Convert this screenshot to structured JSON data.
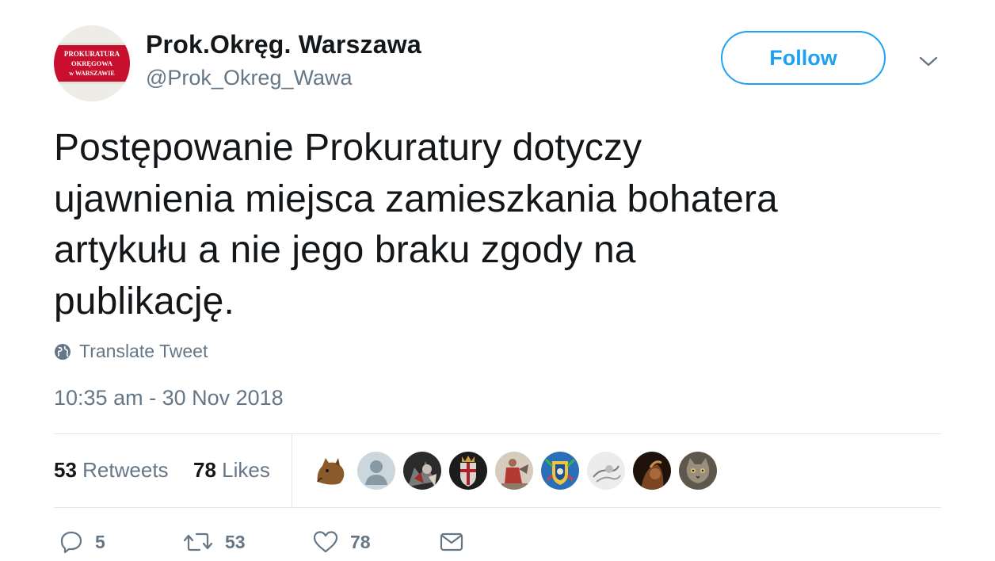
{
  "user": {
    "display_name": "Prok.Okręg. Warszawa",
    "handle": "@Prok_Okreg_Wawa",
    "avatar_text": [
      "PROKURATURA",
      "OKRĘGOWA",
      "w WARSZAWIE"
    ]
  },
  "header": {
    "follow_label": "Follow",
    "menu_icon": "chevron-down-icon"
  },
  "tweet": {
    "lines": [
      "Postępowanie Prokuratury dotyczy",
      "ujawnienia miejsca zamieszkania bohatera",
      "artykułu a nie jego braku zgody na",
      "publikację."
    ],
    "translate_label": "Translate Tweet",
    "timestamp": "10:35 am - 30 Nov 2018"
  },
  "stats": {
    "retweets_count": "53",
    "retweets_label": "Retweets",
    "likes_count": "78",
    "likes_label": "Likes"
  },
  "likers": [
    {
      "name": "horse-mask-avatar",
      "color": "#8a5a2b"
    },
    {
      "name": "default-avatar",
      "color": "#ccd6dd"
    },
    {
      "name": "dark-illustration-avatar",
      "color": "#2b2b2b"
    },
    {
      "name": "coat-of-arms-avatar",
      "color": "#6b1f1f"
    },
    {
      "name": "historical-painting-avatar",
      "color": "#c9b7a8"
    },
    {
      "name": "heraldic-crest-avatar",
      "color": "#1f4fa3"
    },
    {
      "name": "sketch-avatar",
      "color": "#d8d8d8"
    },
    {
      "name": "dark-portrait-avatar",
      "color": "#3a2313"
    },
    {
      "name": "cat-avatar",
      "color": "#7d7466"
    }
  ],
  "actions": {
    "replies_count": "5",
    "retweets_count": "53",
    "likes_count": "78"
  },
  "colors": {
    "accent": "#1da1f2",
    "text_primary": "#14171a",
    "text_secondary": "#657786",
    "divider": "#e1e8ed"
  }
}
